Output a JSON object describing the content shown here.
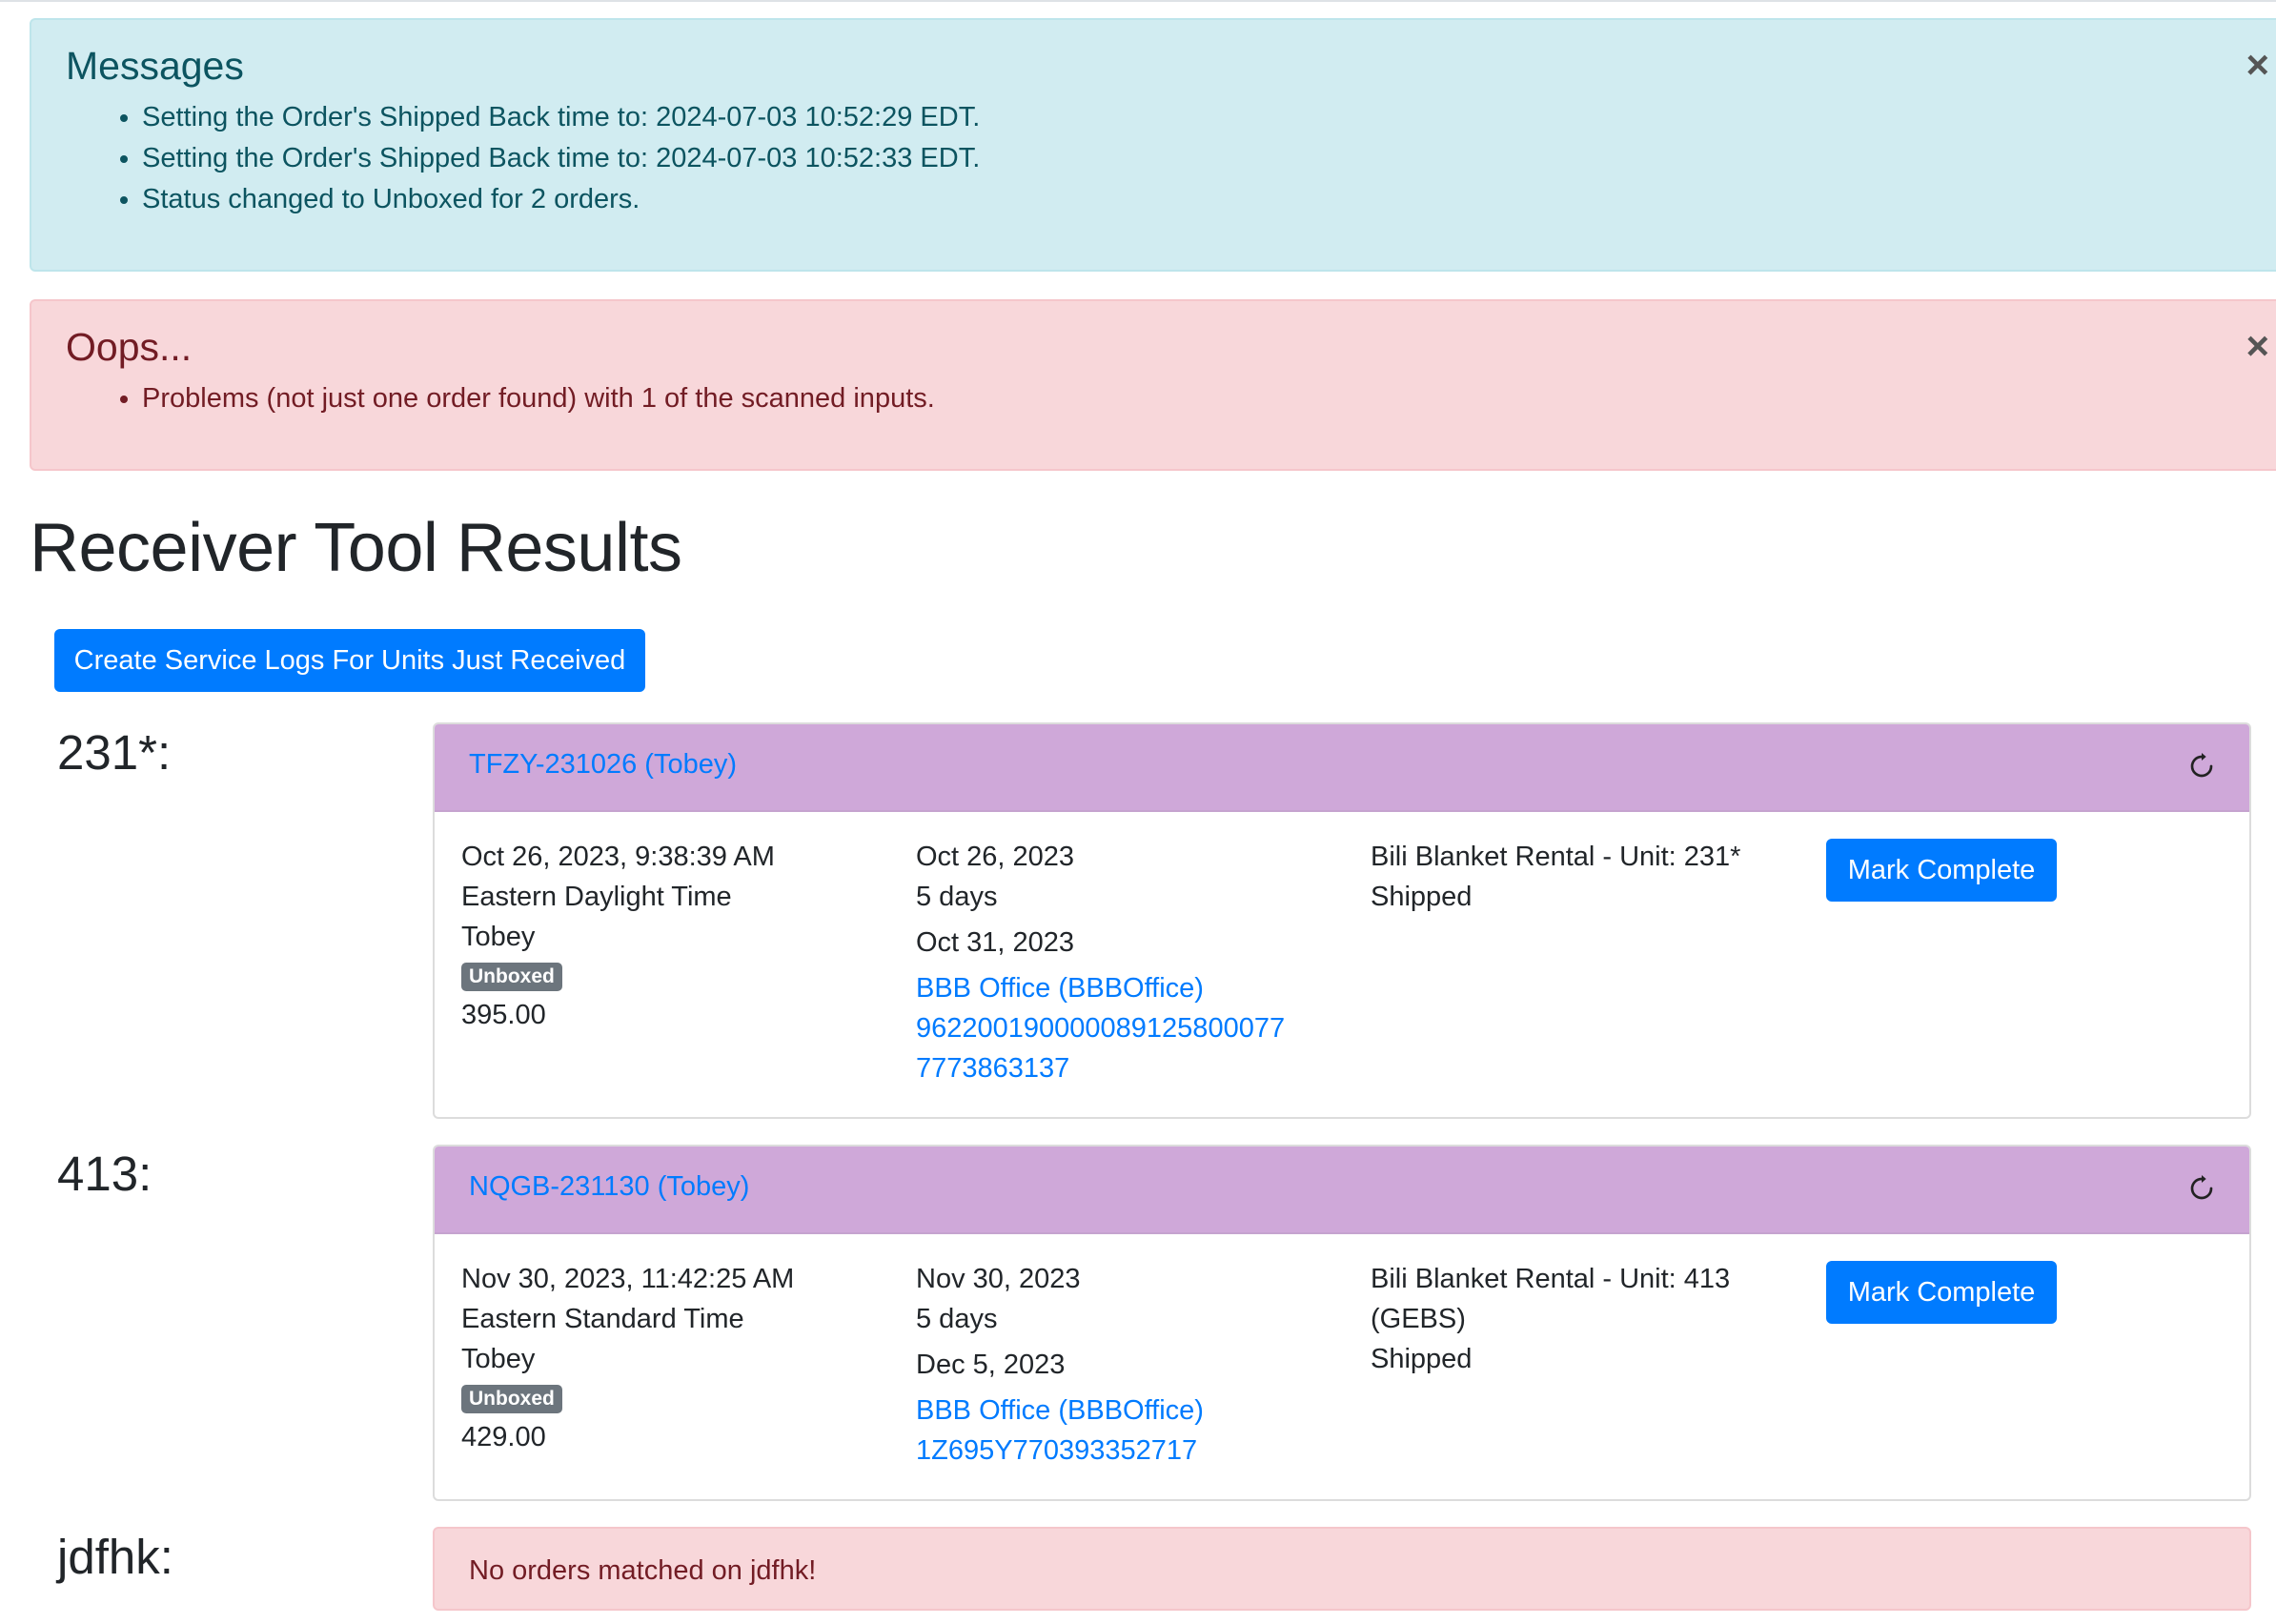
{
  "messages": {
    "title": "Messages",
    "items": [
      "Setting the Order's Shipped Back time to: 2024-07-03 10:52:29 EDT.",
      "Setting the Order's Shipped Back time to: 2024-07-03 10:52:33 EDT.",
      "Status changed to Unboxed for 2 orders."
    ],
    "close": "×"
  },
  "errors": {
    "title": "Oops...",
    "items": [
      "Problems (not just one order found) with 1 of the scanned inputs."
    ],
    "close": "×"
  },
  "page_title": "Receiver Tool Results",
  "create_button": "Create Service Logs For Units Just Received",
  "results": [
    {
      "unit": "231*:",
      "order_link": "TFZY-231026 (Tobey)",
      "created": "Oct 26, 2023, 9:38:39 AM",
      "timezone": "Eastern Daylight Time",
      "customer": "Tobey",
      "status_badge": "Unboxed",
      "amount": "395.00",
      "start_date": "Oct 26, 2023",
      "duration": "5 days",
      "end_date": "Oct 31, 2023",
      "location_link": "BBB Office (BBBOffice)",
      "tracking_1": "9622001900000891258000​77",
      "tracking_2": "7773863137",
      "product_line1": "Bili Blanket Rental - Unit: 231*",
      "product_line2": "",
      "shipment_status": "Shipped",
      "action": "Mark Complete"
    },
    {
      "unit": "413:",
      "order_link": "NQGB-231130 (Tobey)",
      "created": "Nov 30, 2023, 11:42:25 AM",
      "timezone": "Eastern Standard Time",
      "customer": "Tobey",
      "status_badge": "Unboxed",
      "amount": "429.00",
      "start_date": "Nov 30, 2023",
      "duration": "5 days",
      "end_date": "Dec 5, 2023",
      "location_link": "BBB Office (BBBOffice)",
      "tracking_1": "1Z695Y770393352717",
      "product_line1": "Bili Blanket Rental - Unit: 413",
      "product_line2": "(GEBS)",
      "shipment_status": "Shipped",
      "action": "Mark Complete"
    }
  ],
  "no_match": {
    "unit": "jdfhk:",
    "message": "No orders matched on jdfhk!"
  },
  "icons": {
    "refresh": "refresh-icon",
    "close": "close-icon"
  },
  "colors": {
    "primary": "#007bff",
    "card_header": "#cfa8d9",
    "info_bg": "#d1ecf1",
    "danger_bg": "#f8d7da",
    "badge": "#6c757d"
  }
}
